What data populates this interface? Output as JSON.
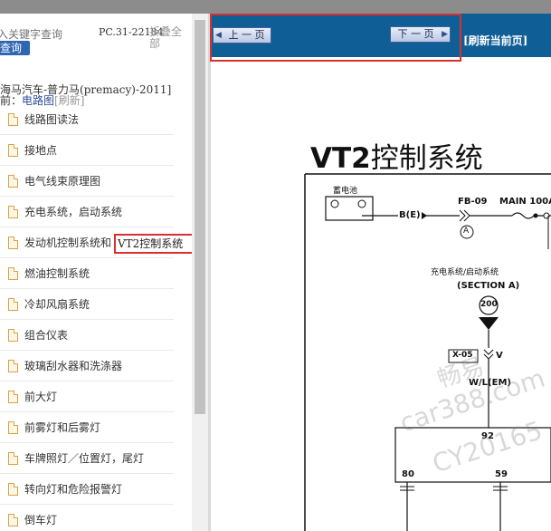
{
  "sidebar": {
    "search_placeholder": "入关键字查询",
    "search_button": "查询",
    "model_code": "PC.31-22184",
    "collapse_all": "折叠全部",
    "vehicle_name": "海马汽车-普力马(premacy)-2011]",
    "current_label": "前：",
    "current_link": "电路图",
    "refresh": "[刷新]",
    "items": [
      {
        "label": "线路图读法"
      },
      {
        "label": "接地点"
      },
      {
        "label": "电气线束原理图"
      },
      {
        "label": "充电系统，启动系统"
      },
      {
        "label": "发动机控制系统和"
      },
      {
        "label": "燃油控制系统"
      },
      {
        "label": "冷却风扇系统"
      },
      {
        "label": "组合仪表"
      },
      {
        "label": "玻璃刮水器和洗涤器"
      },
      {
        "label": "前大灯"
      },
      {
        "label": "前雾灯和后雾灯"
      },
      {
        "label": "车牌照灯／位置灯，尾灯"
      },
      {
        "label": "转向灯和危险报警灯"
      },
      {
        "label": "倒车灯"
      }
    ],
    "tooltip": "VT2控制系统"
  },
  "toolbar": {
    "prev_label": "上 一 页",
    "next_label": "下 一 页",
    "refresh_label": "[刷新当前页]"
  },
  "document": {
    "title_latin": "VT2",
    "title_cjk": "控制系统",
    "battery_label": "蓄电池",
    "minus": "⊖",
    "plus": "⊕",
    "be_label": "B(E)",
    "fb_label": "FB-09",
    "main_label": "MAIN 100A",
    "circle_a": "A",
    "section_cn": "充电系统/启动系统",
    "section_en": "(SECTION A)",
    "node_200": "200",
    "x05": "X-05",
    "v_label": "V",
    "wl_label": "W/L(EM)",
    "pin_92": "92",
    "pin_80": "80",
    "pin_59": "59",
    "watermark_1": "畅易",
    "watermark_2": "car388.com",
    "watermark_3": "CY20165"
  },
  "colors": {
    "toolbar_bg": "#0f5f96",
    "highlight": "#d9302f",
    "search_button": "#2f66b3"
  }
}
